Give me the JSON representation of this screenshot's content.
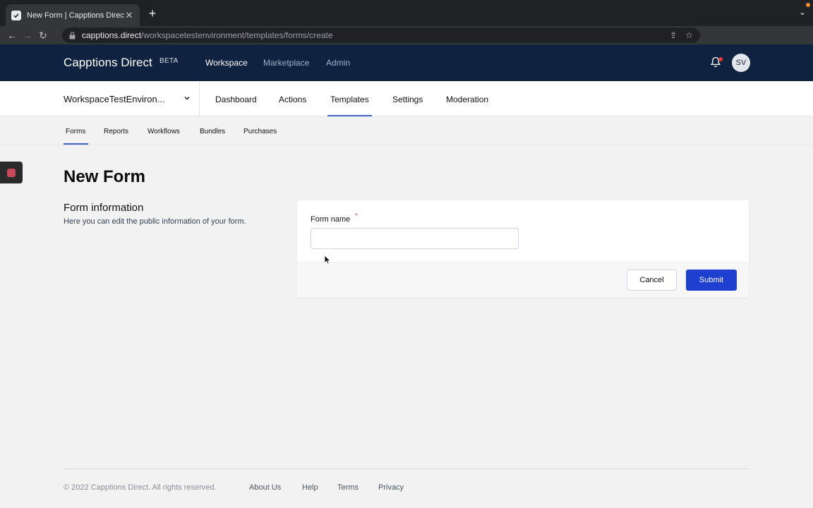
{
  "browser": {
    "tab_title": "New Form | Capptions Direct",
    "url_host": "capptions.direct",
    "url_path": "/workspacetestenvironment/templates/forms/create"
  },
  "header": {
    "brand": "Capptions Direct",
    "badge": "BETA",
    "nav": [
      "Workspace",
      "Marketplace",
      "Admin"
    ],
    "active_nav": "Workspace",
    "avatar_initials": "SV"
  },
  "workspace": {
    "name": "WorkspaceTestEnviron...",
    "nav": [
      "Dashboard",
      "Actions",
      "Templates",
      "Settings",
      "Moderation"
    ],
    "active": "Templates"
  },
  "subnav": {
    "items": [
      "Forms",
      "Reports",
      "Workflows",
      "Bundles",
      "Purchases"
    ],
    "active": "Forms"
  },
  "main": {
    "title": "New Form",
    "section_title": "Form information",
    "section_desc": "Here you can edit the public information of your form.",
    "field_label": "Form name",
    "required_mark": "*",
    "field_value": "",
    "cancel_label": "Cancel",
    "submit_label": "Submit"
  },
  "footer": {
    "copyright": "© 2022 Capptions Direct. All rights reserved.",
    "links": [
      "About Us",
      "Help",
      "Terms",
      "Privacy"
    ]
  },
  "colors": {
    "header_bg": "#0f2340",
    "accent": "#3b64c4",
    "submit_bg": "#1f3fd1",
    "required": "#e05252"
  }
}
